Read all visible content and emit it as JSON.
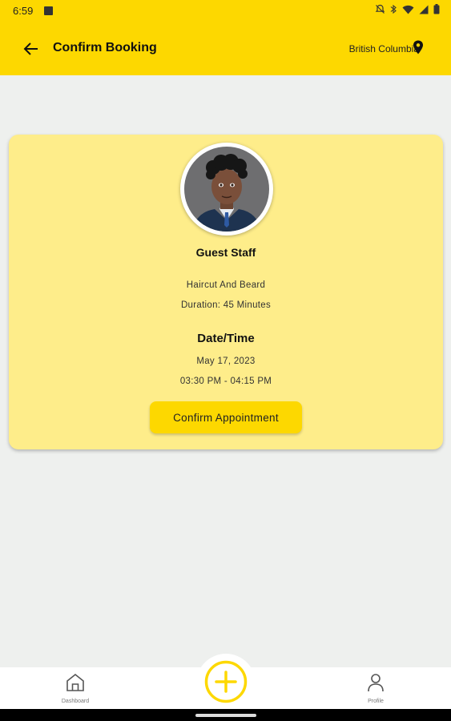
{
  "status_bar": {
    "time": "6:59",
    "icons": [
      "image-icon",
      "notifications-off-icon",
      "bluetooth-icon",
      "wifi-icon",
      "signal-icon",
      "battery-icon"
    ]
  },
  "app_bar": {
    "title": "Confirm Booking",
    "location": "British Columbia",
    "back_icon": "arrow-left-icon",
    "location_icon": "map-pin-icon"
  },
  "booking": {
    "staff_name": "Guest Staff",
    "service": "Haircut And Beard",
    "duration": "Duration: 45 Minutes",
    "datetime_heading": "Date/Time",
    "date": "May 17, 2023",
    "time_range": "03:30 PM - 04:15 PM",
    "confirm_label": "Confirm Appointment"
  },
  "bottom_nav": {
    "dashboard_label": "Dashboard",
    "profile_label": "Profile",
    "add_icon": "plus-circle-icon"
  },
  "colors": {
    "brand_yellow": "#fdd800",
    "card_background": "#feed8a",
    "page_background": "#eef0ee"
  }
}
